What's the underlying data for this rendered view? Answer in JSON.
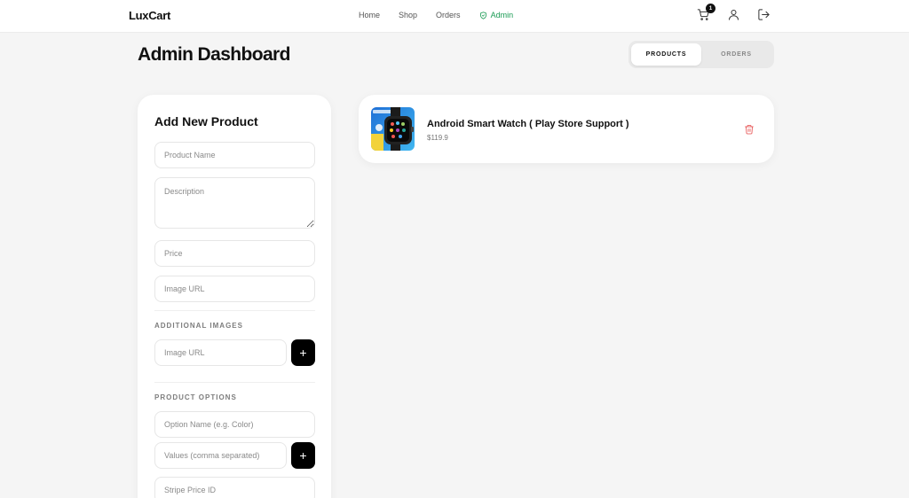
{
  "app": {
    "brand": "LuxCart"
  },
  "nav": {
    "links": [
      "Home",
      "Shop",
      "Orders"
    ],
    "admin_label": "Admin"
  },
  "header_icons": {
    "cart_icon": "cart-icon",
    "cart_count": "1",
    "user_icon": "user-icon",
    "logout_icon": "logout-icon"
  },
  "page": {
    "title": "Admin Dashboard",
    "tabs": [
      {
        "label": "PRODUCTS",
        "active": true
      },
      {
        "label": "ORDERS",
        "active": false
      }
    ]
  },
  "form": {
    "title": "Add New Product",
    "product_name_placeholder": "Product Name",
    "description_placeholder": "Description",
    "price_placeholder": "Price",
    "image_url_placeholder": "Image URL",
    "additional_images_label": "ADDITIONAL IMAGES",
    "additional_image_placeholder": "Image URL",
    "add_button": "+",
    "product_options_label": "PRODUCT OPTIONS",
    "option_name_placeholder": "Option Name (e.g. Color)",
    "option_values_placeholder": "Values (comma separated)",
    "stripe_price_placeholder": "Stripe Price ID"
  },
  "products": [
    {
      "name": "Android Smart Watch ( Play Store Support )",
      "price": "$119.9",
      "delete_icon": "trash-icon"
    }
  ],
  "colors": {
    "accent_admin": "#1a9b54",
    "delete": "#e54848",
    "primary_button": "#000000"
  }
}
